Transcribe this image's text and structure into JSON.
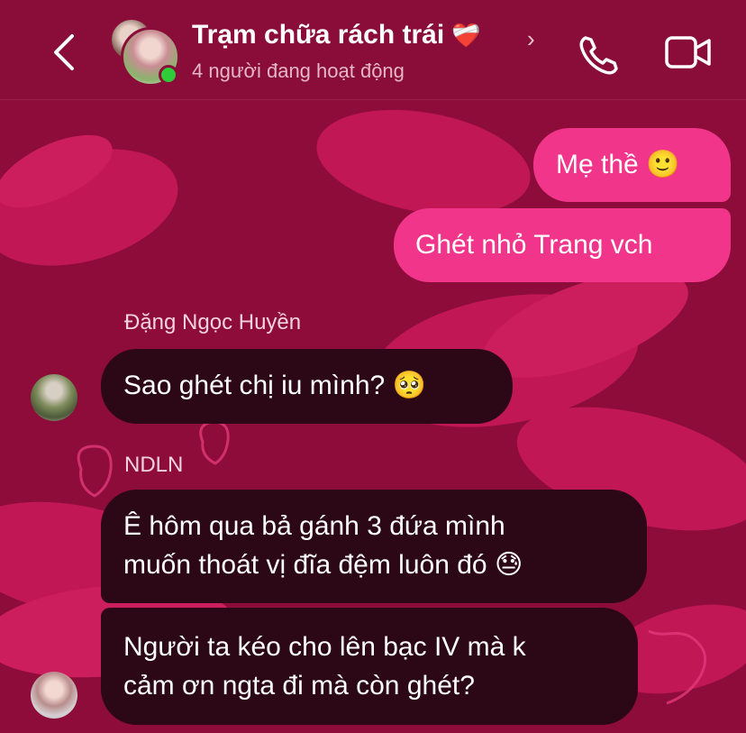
{
  "header": {
    "title": "Trạm chữa rách trái",
    "title_emoji": "❤️‍🩹",
    "subtitle": "4 người đang hoạt động",
    "chevron": "›",
    "icons": [
      "back-arrow-icon",
      "phone-icon",
      "video-camera-icon"
    ]
  },
  "messages": {
    "m1": {
      "text": "Mẹ thề ",
      "emoji": "🙂"
    },
    "m2": {
      "text": "Ghét nhỏ Trang vch"
    },
    "sender1": "Đặng Ngọc Huyền",
    "m3": {
      "text": "Sao ghét chị iu mình? ",
      "emoji": "🥺"
    },
    "sender2": "NDLN",
    "m4": {
      "line1": "Ê hôm qua bả gánh 3 đứa mình",
      "line2": "muốn thoát vị đĩa đệm luôn đó ",
      "emoji": "😓"
    },
    "m5": {
      "line1": "Người ta kéo cho lên bạc IV mà k",
      "line2": "cảm ơn ngta đi mà còn ghét?"
    }
  },
  "theme": {
    "background": "#8e0c3a",
    "outgoing_bubble": "#f0358a",
    "incoming_bubble": "#2c0716",
    "online": "#2fcc3a"
  }
}
